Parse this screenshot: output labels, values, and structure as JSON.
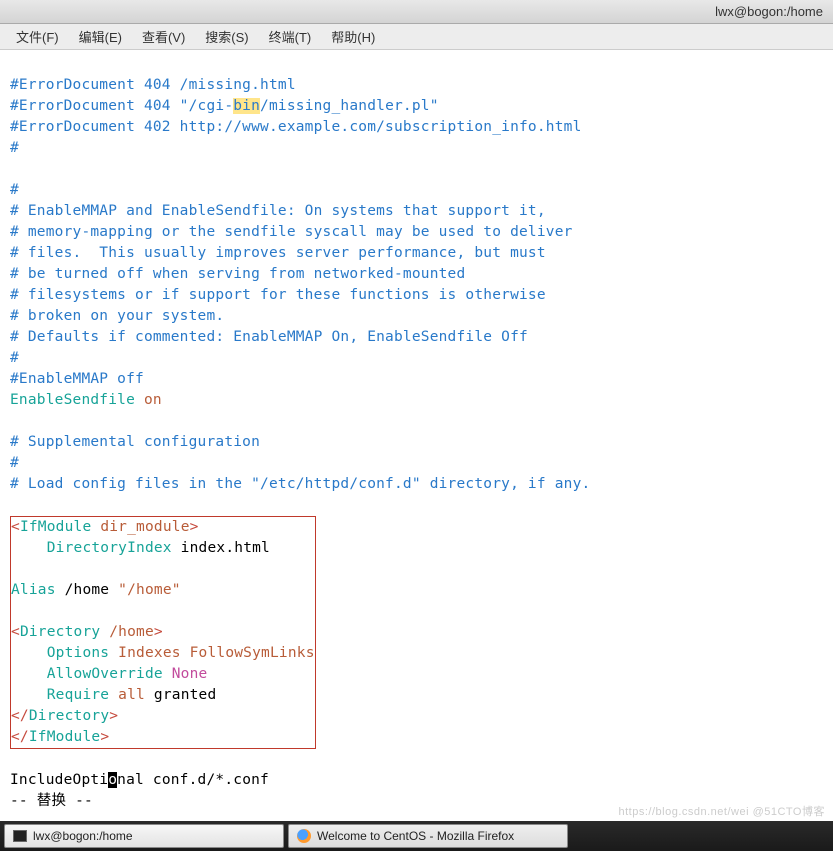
{
  "window": {
    "title": "lwx@bogon:/home"
  },
  "menu": {
    "file": "文件(F)",
    "edit": "编辑(E)",
    "view": "查看(V)",
    "search": "搜索(S)",
    "terminal": "终端(T)",
    "help": "帮助(H)"
  },
  "code": {
    "l1a": "#ErrorDocument 404 /missing.html",
    "l2a": "#ErrorDocument 404 \"/cgi-",
    "l2hl": "bin",
    "l2b": "/missing_handler.pl\"",
    "l3": "#ErrorDocument 402 http://www.example.com/subscription_info.html",
    "l4": "#",
    "l5": "#",
    "l6": "# EnableMMAP and EnableSendfile: On systems that support it,",
    "l7": "# memory-mapping or the sendfile syscall may be used to deliver",
    "l8": "# files.  This usually improves server performance, but must",
    "l9": "# be turned off when serving from networked-mounted",
    "l10": "# filesystems or if support for these functions is otherwise",
    "l11": "# broken on your system.",
    "l12": "# Defaults if commented: EnableMMAP On, EnableSendfile Off",
    "l13": "#",
    "l14": "#EnableMMAP off",
    "l15a": "EnableSendfile",
    "l15b": " on",
    "l16": "# Supplemental configuration",
    "l17": "#",
    "l18": "# Load config files in the \"/etc/httpd/conf.d\" directory, if any.",
    "box": {
      "b1a": "<",
      "b1b": "IfModule",
      "b1c": " dir_module",
      "b1d": ">",
      "b2a": "    DirectoryIndex",
      "b2b": " index.html",
      "b3a": "Alias",
      "b3b": " /home ",
      "b3c": "\"/home\"",
      "b4a": "<",
      "b4b": "Directory",
      "b4c": " /home",
      "b4d": ">",
      "b5a": "    Options",
      "b5b": " Indexes FollowSymLinks",
      "b6a": "    AllowOverride",
      "b6b": " None",
      "b7a": "    Require",
      "b7b": " all",
      "b7c": " granted",
      "b8a": "</",
      "b8b": "Directory",
      "b8c": ">",
      "b9a": "</",
      "b9b": "IfModule",
      "b9c": ">"
    },
    "inc_a": "IncludeOpti",
    "inc_cur": "o",
    "inc_b": "nal conf.d/*.conf",
    "status": "-- 替换 --"
  },
  "taskbar": {
    "item1": "lwx@bogon:/home",
    "item2": "Welcome to CentOS - Mozilla Firefox"
  },
  "watermark": "https://blog.csdn.net/wei  @51CTO博客"
}
